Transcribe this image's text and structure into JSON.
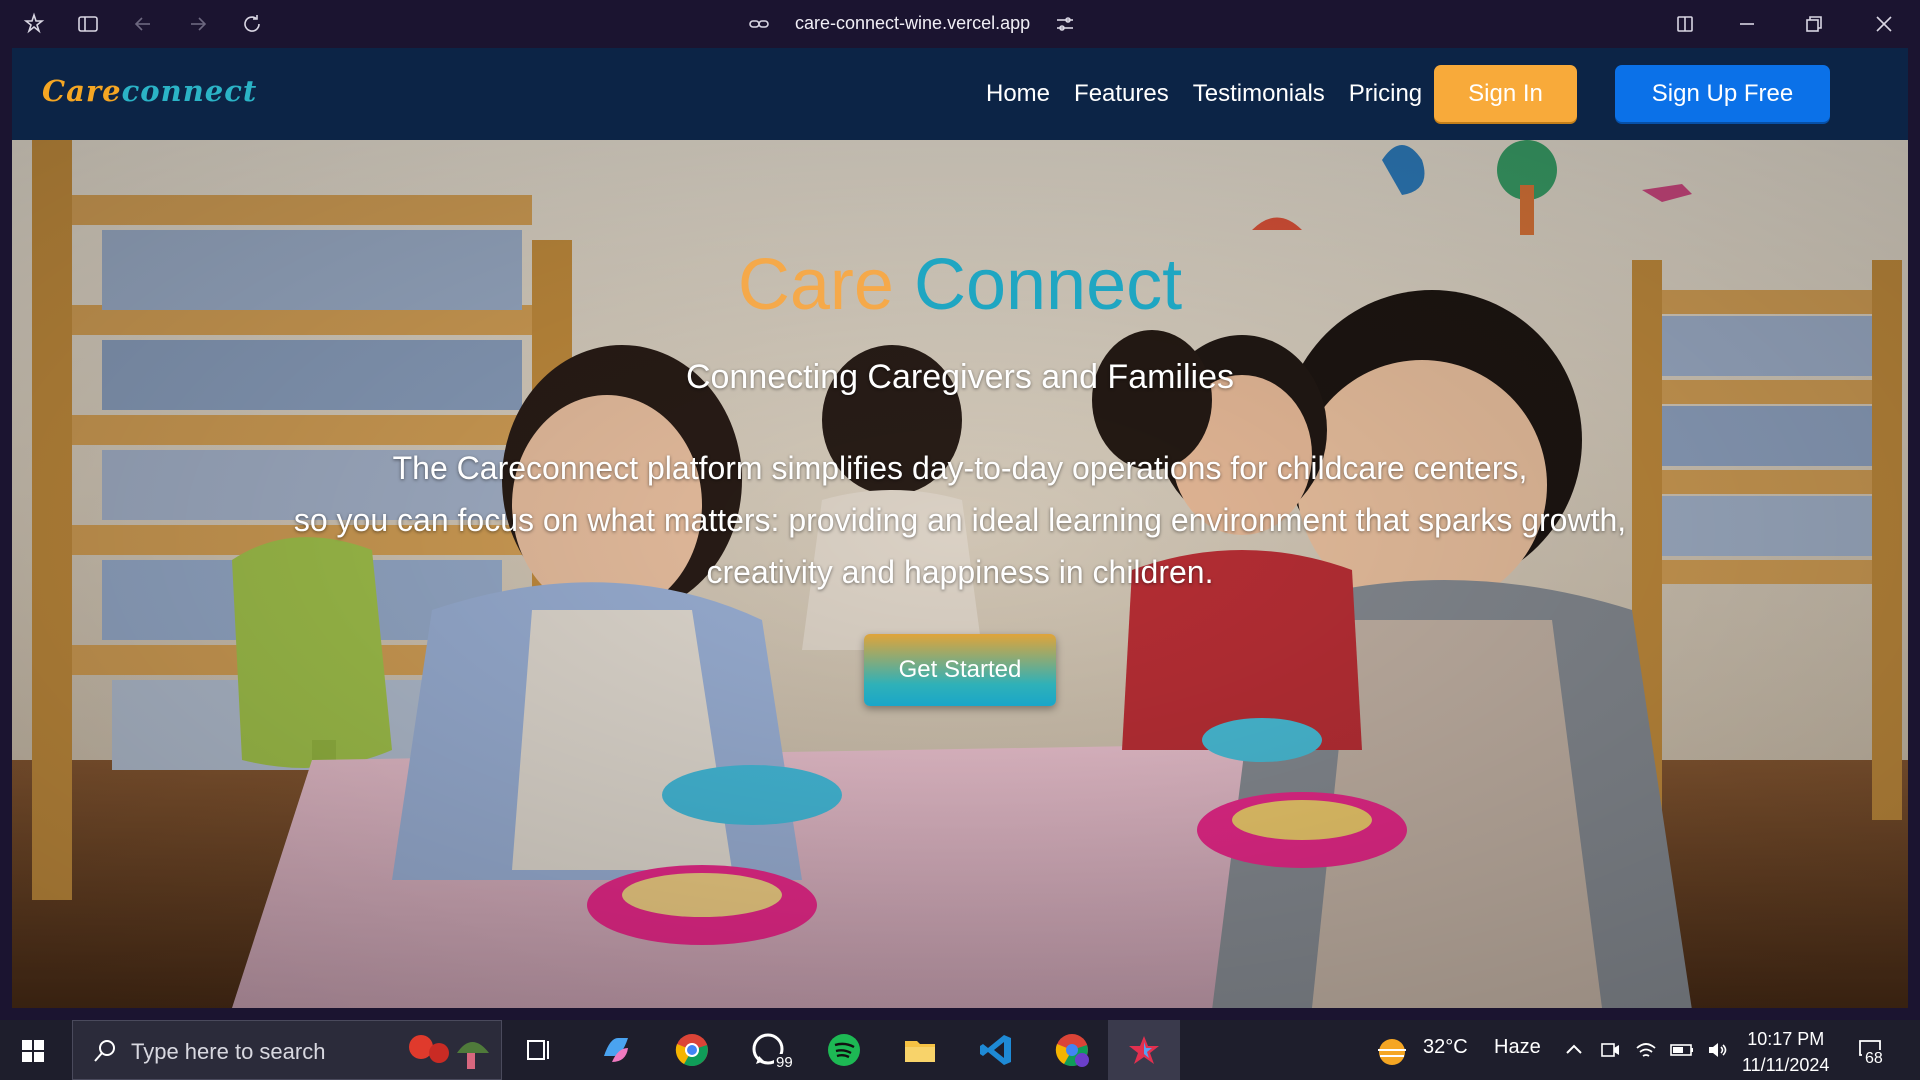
{
  "browser": {
    "url": "care-connect-wine.vercel.app"
  },
  "navbar": {
    "logo_part1": "Care",
    "logo_part2": "connect",
    "links": [
      "Home",
      "Features",
      "Testimonials",
      "Pricing"
    ],
    "signin_label": "Sign In",
    "signup_label": "Sign Up Free"
  },
  "hero": {
    "title_part1": "Care",
    "title_part2": "Connect",
    "subtitle": "Connecting Caregivers and Families",
    "description_lines": [
      "The Careconnect platform simplifies day-to-day operations for childcare centers,",
      "so you can focus on what matters: providing an ideal learning environment that sparks growth,",
      "creativity and happiness in children."
    ],
    "cta_label": "Get Started"
  },
  "taskbar": {
    "search_placeholder": "Type here to search",
    "whatsapp_badge": "99",
    "weather_temp": "32°C",
    "weather_desc": "Haze",
    "time": "10:17 PM",
    "date": "11/11/2024",
    "notification_count": "68"
  },
  "colors": {
    "nav_bg": "#0c2446",
    "signin_bg": "#f8aa3a",
    "signup_bg": "#0b71e8",
    "title_orange": "#f5a94a",
    "title_teal": "#1fa6c2"
  }
}
